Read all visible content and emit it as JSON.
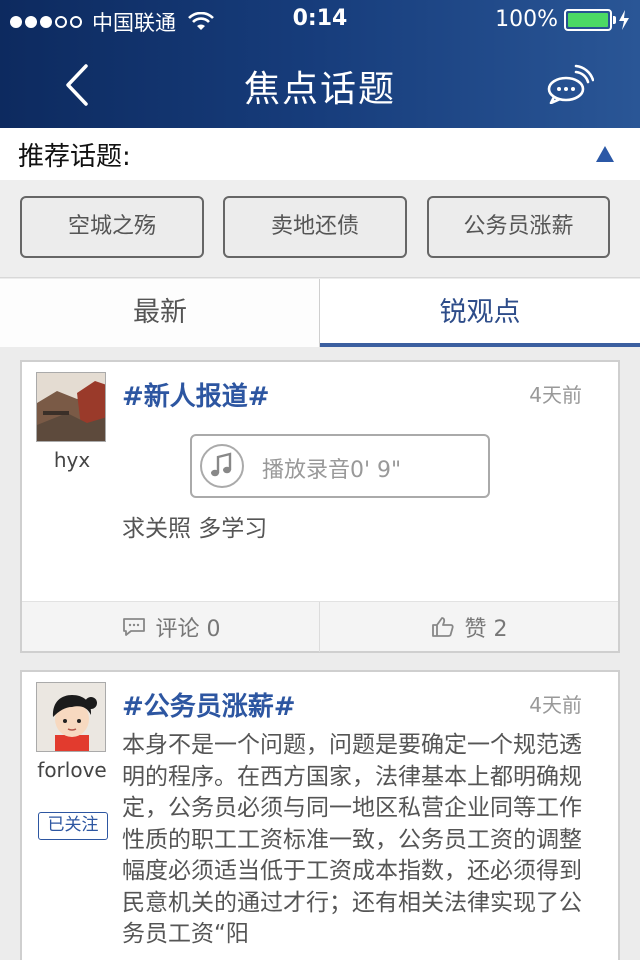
{
  "status_bar": {
    "carrier": "中国联通",
    "time": "0:14",
    "battery": "100%"
  },
  "nav": {
    "title": "焦点话题"
  },
  "recommend": {
    "label": "推荐话题:",
    "topics": [
      "空城之殇",
      "卖地还债",
      "公务员涨薪"
    ]
  },
  "tabs": [
    {
      "label": "最新",
      "active": false
    },
    {
      "label": "锐观点",
      "active": true
    }
  ],
  "posts": [
    {
      "username": "hyx",
      "hashtag": "#新人报道#",
      "time_ago": "4天前",
      "audio_label": "播放录音0' 9\"",
      "text": "求关照 多学习",
      "comment_label": "评论 0",
      "like_label": "赞 2"
    },
    {
      "username": "forlove",
      "follow_label": "已关注",
      "hashtag": "#公务员涨薪#",
      "time_ago": "4天前",
      "text": "本身不是一个问题，问题是要确定一个规范透明的程序。在西方国家，法律基本上都明确规定，公务员必须与同一地区私营企业同等工作性质的职工工资标准一致，公务员工资的调整幅度必须适当低于工资成本指数，还必须得到民意机关的通过才行；还有相关法律实现了公务员工资“阳"
    }
  ],
  "colors": {
    "nav_bg": "#173d7c",
    "accent": "#2d56a1",
    "battery": "#4cd964"
  }
}
